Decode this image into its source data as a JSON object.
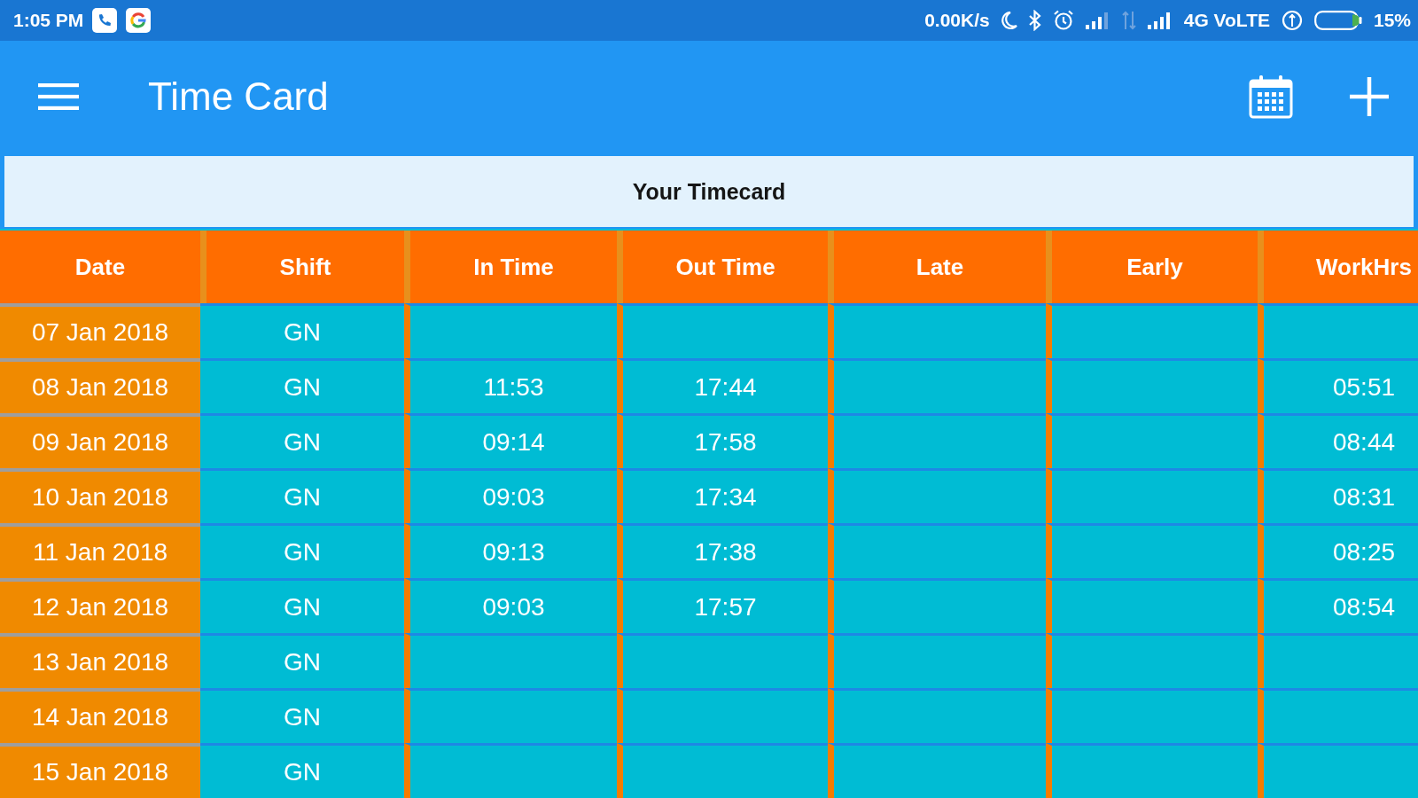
{
  "status_bar": {
    "time": "1:05 PM",
    "net_speed": "0.00K/s",
    "network": "4G VoLTE",
    "battery_percent": "15%"
  },
  "app_bar": {
    "title": "Time Card"
  },
  "panel": {
    "title": "Your Timecard"
  },
  "table": {
    "columns": [
      "Date",
      "Shift",
      "In Time",
      "Out Time",
      "Late",
      "Early",
      "WorkHrs"
    ],
    "rows": [
      {
        "date": "07 Jan 2018",
        "shift": "GN"
      },
      {
        "date": "08 Jan 2018",
        "shift": "GN",
        "in_time": "11:53",
        "out_time": "17:44",
        "work_hrs": "05:51"
      },
      {
        "date": "09 Jan 2018",
        "shift": "GN",
        "in_time": "09:14",
        "out_time": "17:58",
        "work_hrs": "08:44"
      },
      {
        "date": "10 Jan 2018",
        "shift": "GN",
        "in_time": "09:03",
        "out_time": "17:34",
        "work_hrs": "08:31"
      },
      {
        "date": "11 Jan 2018",
        "shift": "GN",
        "in_time": "09:13",
        "out_time": "17:38",
        "work_hrs": "08:25"
      },
      {
        "date": "12 Jan 2018",
        "shift": "GN",
        "in_time": "09:03",
        "out_time": "17:57",
        "work_hrs": "08:54"
      },
      {
        "date": "13 Jan 2018",
        "shift": "GN"
      },
      {
        "date": "14 Jan 2018",
        "shift": "GN"
      },
      {
        "date": "15 Jan 2018",
        "shift": "GN"
      }
    ]
  }
}
